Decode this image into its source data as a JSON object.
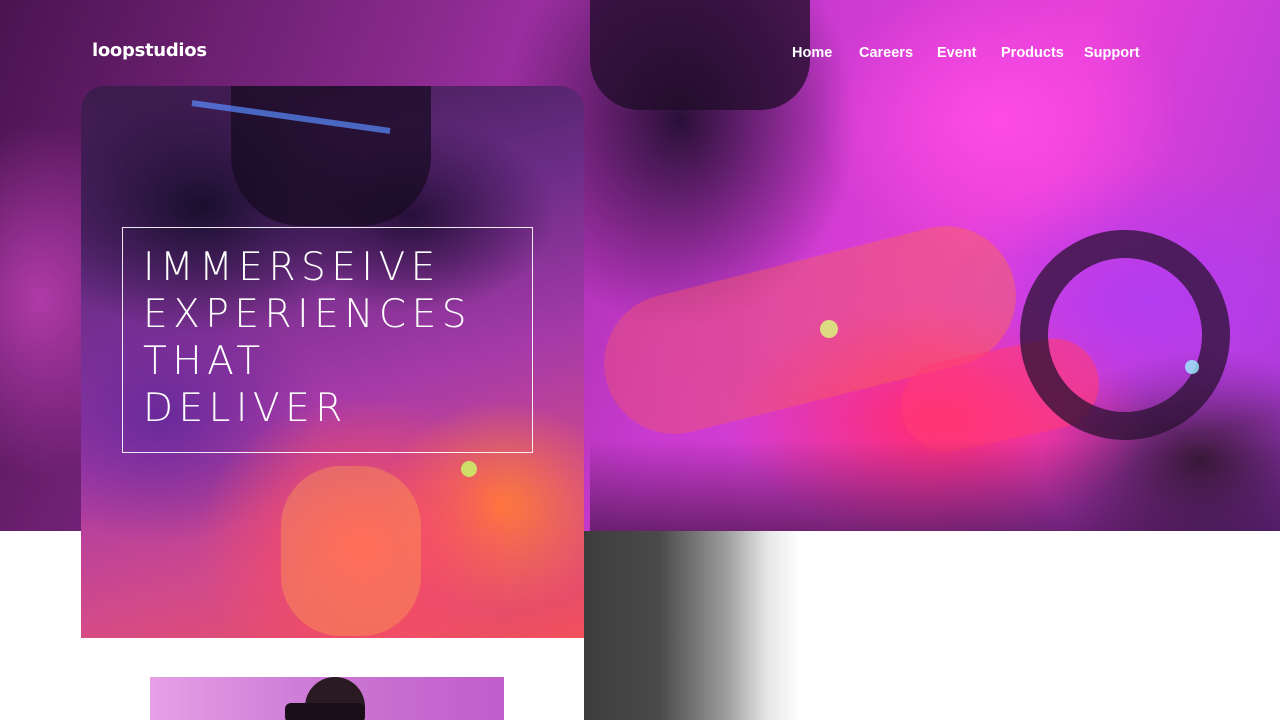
{
  "header": {
    "logo": "loopstudios"
  },
  "nav": {
    "items": [
      {
        "label": "Home"
      },
      {
        "label": "Careers"
      },
      {
        "label": "Event"
      },
      {
        "label": "Products"
      },
      {
        "label": "Support"
      }
    ]
  },
  "hero": {
    "headline_lines": [
      "IMMERSEIVE",
      "EXPERIENCES",
      "THAT",
      "DELIVER"
    ]
  },
  "colors": {
    "text_on_dark": "#ffffff",
    "hero_magenta": "#e640d8",
    "hero_pink_red": "#ff3b78",
    "page_background": "#ffffff"
  },
  "icons": []
}
